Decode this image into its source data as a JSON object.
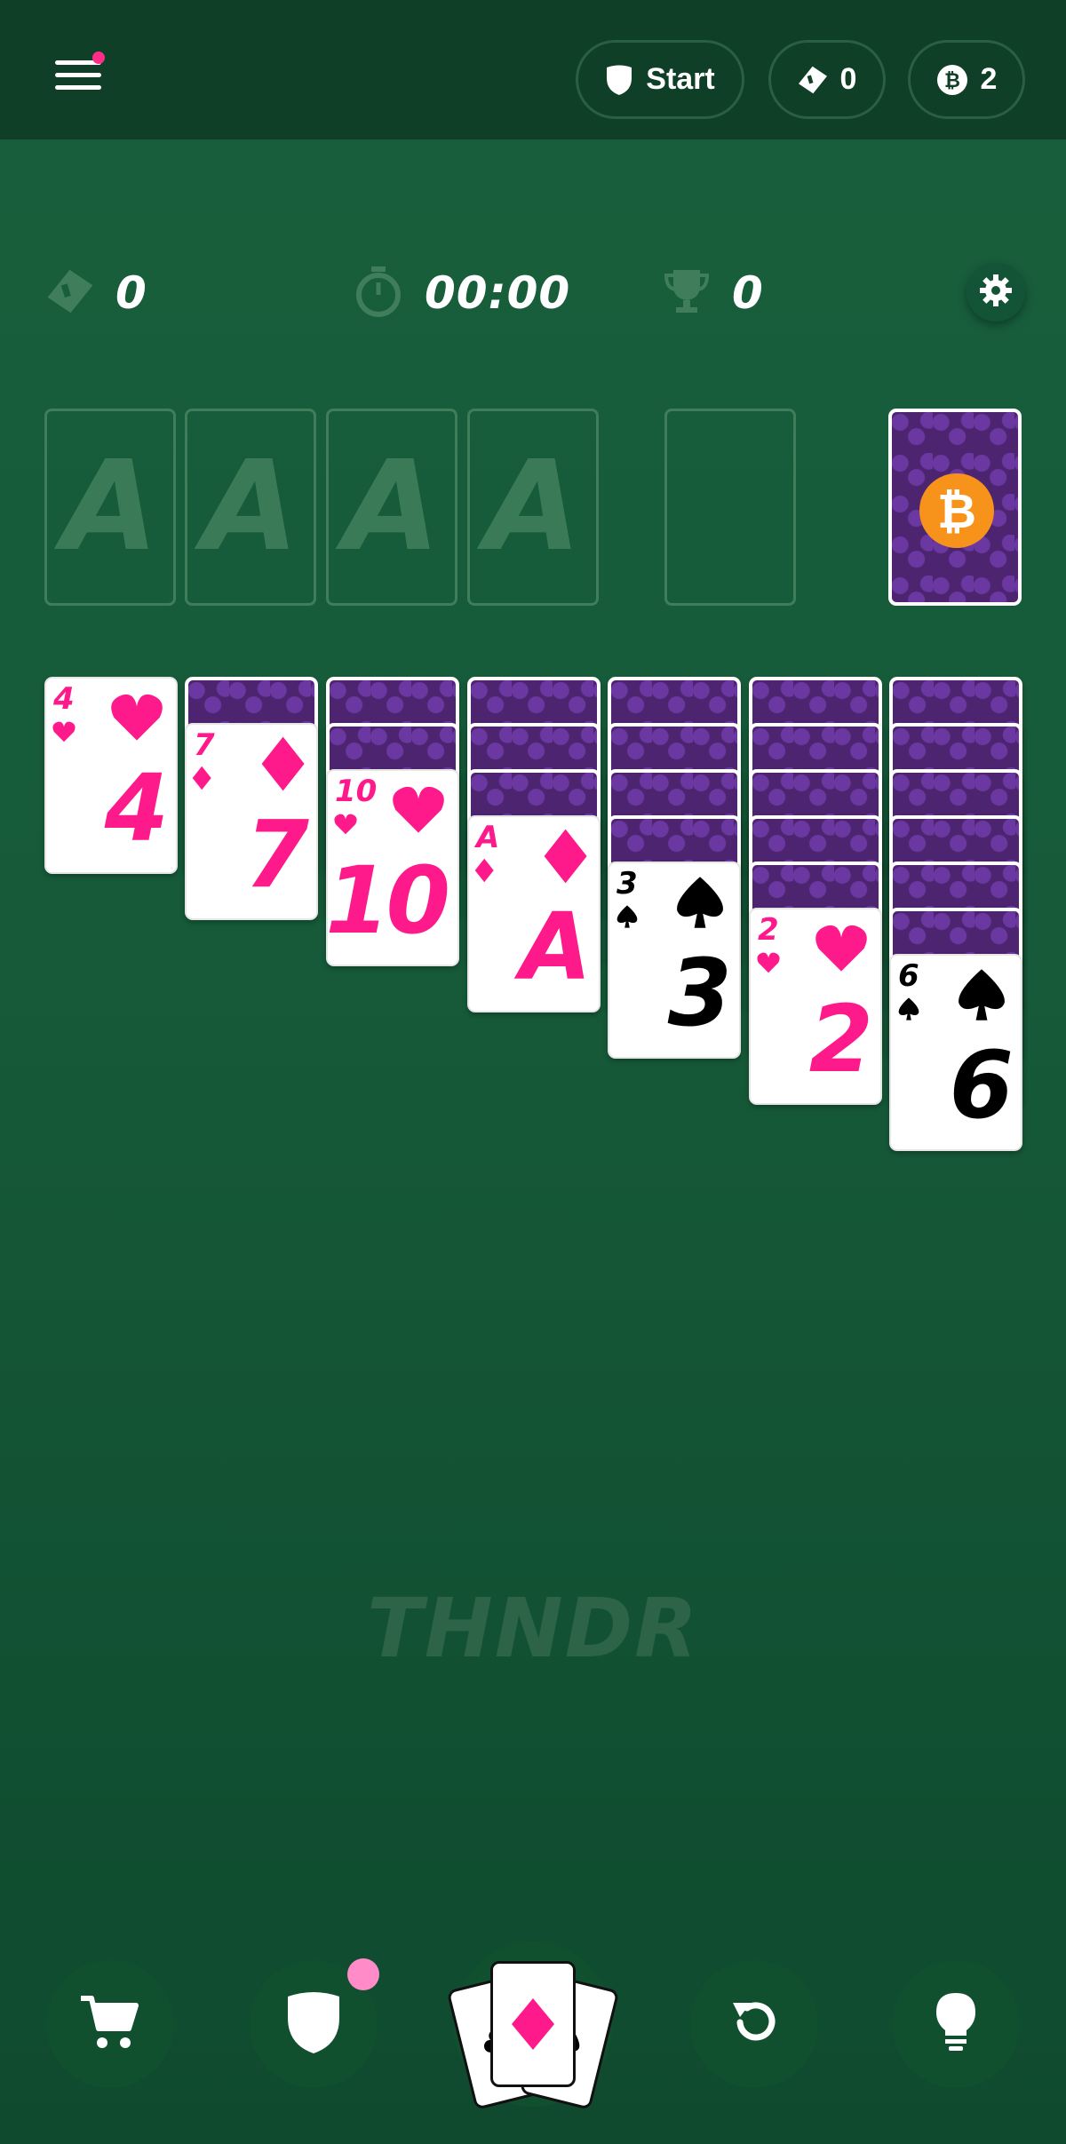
{
  "topbar": {
    "menu_icon": "hamburger-icon",
    "start_label": "Start",
    "tickets_count": "0",
    "bitcoin_count": "2"
  },
  "stats": {
    "moves": "0",
    "timer": "00:00",
    "score": "0"
  },
  "foundations": [
    "A",
    "A",
    "A",
    "A"
  ],
  "tableau": [
    {
      "hidden": 0,
      "card": {
        "rank": "4",
        "suit": "hearts",
        "color": "red"
      }
    },
    {
      "hidden": 1,
      "card": {
        "rank": "7",
        "suit": "diamonds",
        "color": "red"
      }
    },
    {
      "hidden": 2,
      "card": {
        "rank": "10",
        "suit": "hearts",
        "color": "red"
      }
    },
    {
      "hidden": 3,
      "card": {
        "rank": "A",
        "suit": "diamonds",
        "color": "red"
      }
    },
    {
      "hidden": 4,
      "card": {
        "rank": "3",
        "suit": "spades",
        "color": "black"
      }
    },
    {
      "hidden": 5,
      "card": {
        "rank": "2",
        "suit": "hearts",
        "color": "red"
      }
    },
    {
      "hidden": 6,
      "card": {
        "rank": "6",
        "suit": "spades",
        "color": "black"
      }
    }
  ],
  "watermark": "THNDR",
  "bottom_nav": [
    "cart-icon",
    "shield-icon",
    "deal-cards-icon",
    "undo-icon",
    "hint-bulb-icon"
  ],
  "colors": {
    "background": "#185f3c",
    "topbar": "#0f3f27",
    "red_suit": "#ff1a8c",
    "card_back": "#4d2470",
    "bitcoin": "#f7931a",
    "notification": "#ff2d87"
  }
}
